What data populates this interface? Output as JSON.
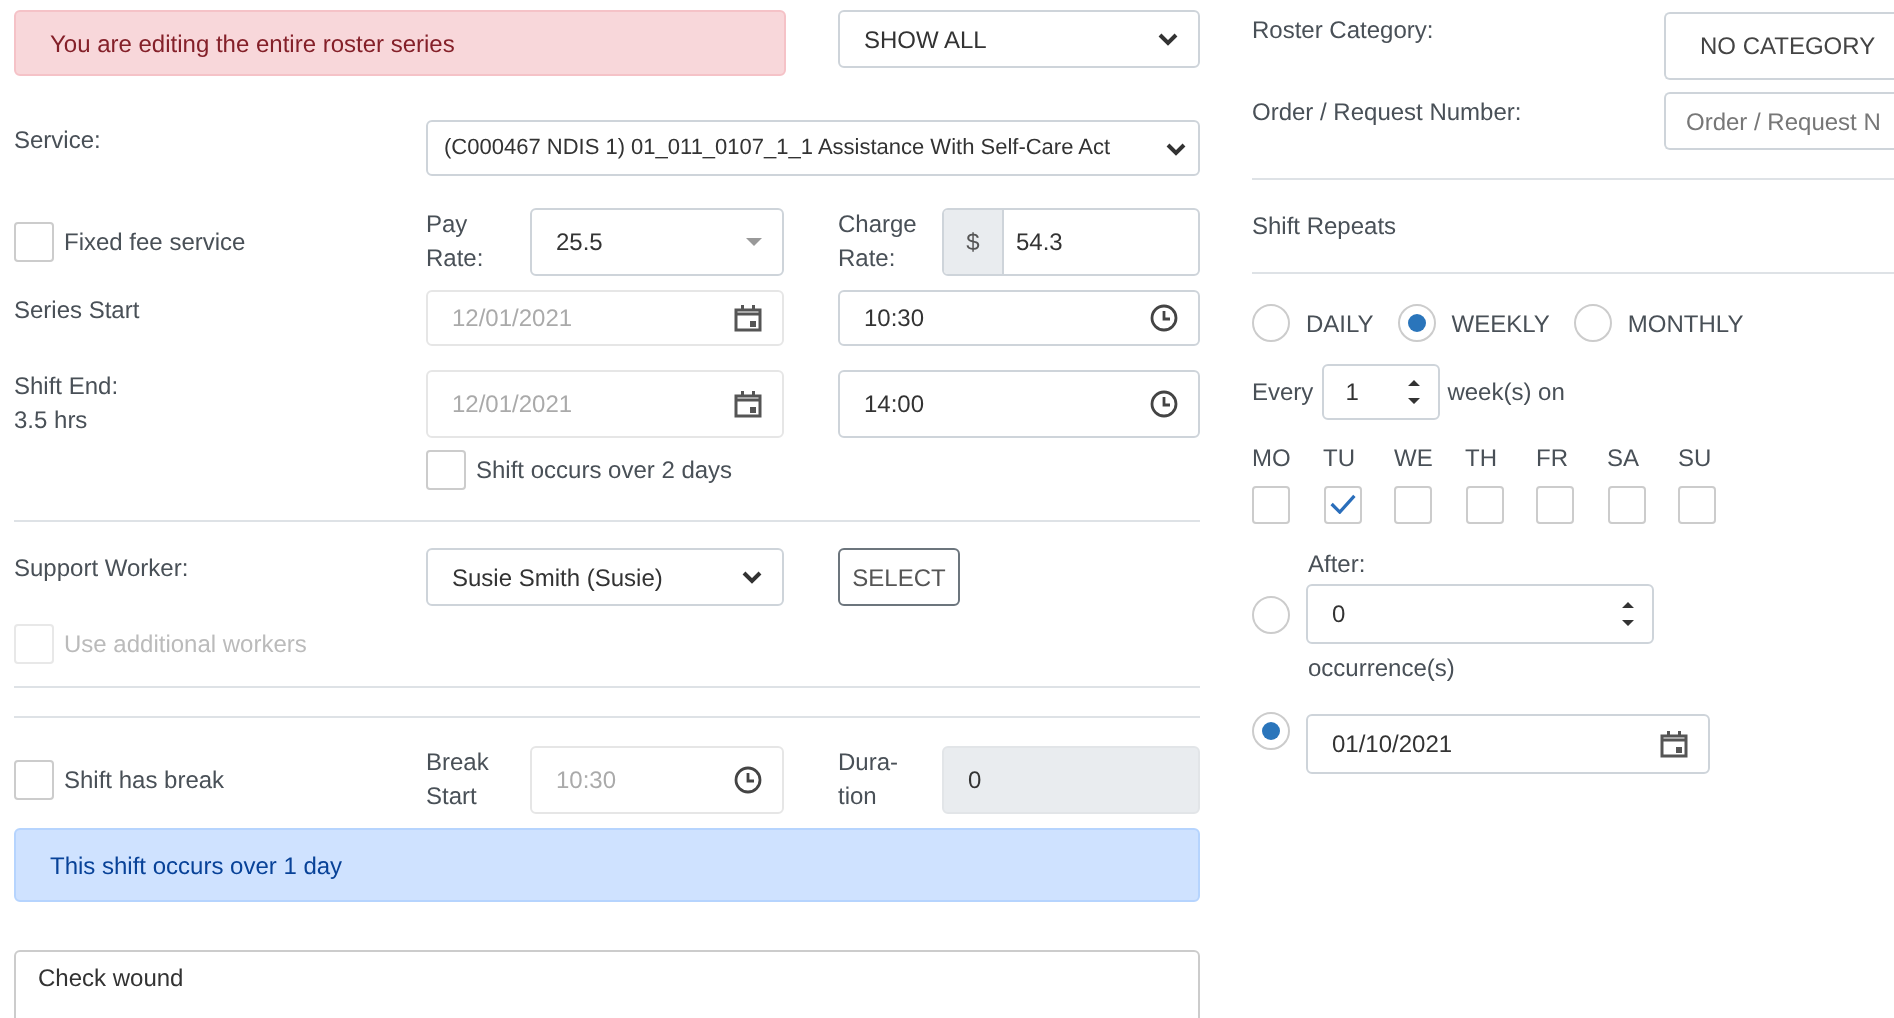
{
  "alert": {
    "text": "You are editing the entire roster series"
  },
  "filter_select": {
    "value": "SHOW ALL"
  },
  "service": {
    "label": "Service:",
    "value": "(C000467 NDIS 1) 01_011_0107_1_1 Assistance With Self-Care Act"
  },
  "fixed_fee": {
    "label": "Fixed fee service",
    "checked": false
  },
  "pay_rate": {
    "label": "Pay Rate:",
    "value": "25.5"
  },
  "charge_rate": {
    "label": "Charge Rate:",
    "prefix": "$",
    "value": "54.3"
  },
  "series_start": {
    "label": "Series Start",
    "date": "12/01/2021",
    "date_disabled": true,
    "time": "10:30"
  },
  "shift_end": {
    "label": "Shift End:",
    "hours": "3.5 hrs",
    "date": "12/01/2021",
    "date_disabled": true,
    "time": "14:00"
  },
  "over_two_days": {
    "label": "Shift occurs over 2 days",
    "checked": false
  },
  "support_worker": {
    "label": "Support Worker:",
    "value": "Susie Smith (Susie)",
    "button": "SELECT"
  },
  "additional_workers": {
    "label": "Use additional workers",
    "checked": false,
    "disabled": true
  },
  "shift_break": {
    "label": "Shift has break",
    "checked": false,
    "start_label": "Break Start",
    "start": "10:30",
    "start_disabled": true,
    "duration_label": "Dura-tion",
    "duration": "0"
  },
  "info": {
    "text": "This shift occurs over 1 day"
  },
  "notes": {
    "value": "Check wound"
  },
  "roster_category": {
    "label": "Roster Category:",
    "value": "NO CATEGORY"
  },
  "order_number": {
    "label": "Order / Request Number:",
    "placeholder": "Order / Request N"
  },
  "shift_repeats": {
    "label": "Shift Repeats"
  },
  "frequency": [
    {
      "label": "DAILY",
      "selected": false
    },
    {
      "label": "WEEKLY",
      "selected": true
    },
    {
      "label": "MONTHLY",
      "selected": false
    }
  ],
  "every": {
    "label": "Every",
    "value": "1",
    "unit": "week(s) on"
  },
  "days": [
    {
      "label": "MO",
      "checked": false
    },
    {
      "label": "TU",
      "checked": true
    },
    {
      "label": "WE",
      "checked": false
    },
    {
      "label": "TH",
      "checked": false
    },
    {
      "label": "FR",
      "checked": false
    },
    {
      "label": "SA",
      "checked": false
    },
    {
      "label": "SU",
      "checked": false
    }
  ],
  "end_options": [
    {
      "kind": "after",
      "label": "After:",
      "value": "0",
      "suffix": "occurrence(s)",
      "selected": false
    },
    {
      "kind": "date",
      "value": "01/10/2021",
      "selected": true
    }
  ]
}
